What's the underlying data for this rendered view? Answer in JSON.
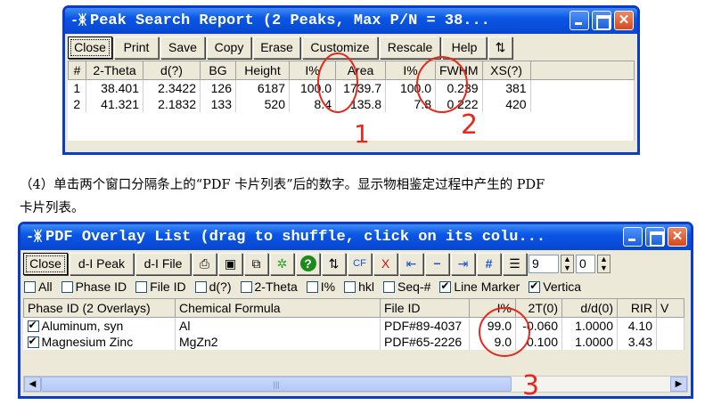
{
  "peak_window": {
    "title": "Peak Search Report (2 Peaks, Max P/N = 38...",
    "buttons": [
      "Close",
      "Print",
      "Save",
      "Copy",
      "Erase",
      "Customize",
      "Rescale",
      "Help"
    ],
    "columns": [
      "#",
      "2-Theta",
      "d(?)",
      "BG",
      "Height",
      "I%",
      "Area",
      "I%",
      "FWHM",
      "XS(?)"
    ],
    "rows": [
      [
        "1",
        "38.401",
        "2.3422",
        "126",
        "6187",
        "100.0",
        "1739.7",
        "100.0",
        "0.239",
        "381"
      ],
      [
        "2",
        "41.321",
        "2.1832",
        "133",
        "520",
        "8.4",
        "135.8",
        "7.8",
        "0.222",
        "420"
      ]
    ]
  },
  "caption": {
    "line1": "（4）单击两个窗口分隔条上的“PDF 卡片列表”后的数字。显示物相鉴定过程中产生的 PDF",
    "line2": "卡片列表。"
  },
  "pdf_window": {
    "title": "PDF Overlay List (drag to shuffle, click on its colu...",
    "buttons": {
      "close": "Close",
      "dl_peak": "d-I Peak",
      "dl_file": "d-I File"
    },
    "icon_buttons": {
      "cf": "CF",
      "x": "X",
      "hash": "#"
    },
    "spin_values": [
      "9",
      "0"
    ],
    "checkboxes": [
      {
        "label": "All",
        "checked": false
      },
      {
        "label": "Phase ID",
        "checked": false
      },
      {
        "label": "File ID",
        "checked": false
      },
      {
        "label": "d(?)",
        "checked": false
      },
      {
        "label": "2-Theta",
        "checked": false
      },
      {
        "label": "I%",
        "checked": false
      },
      {
        "label": "hkl",
        "checked": false
      },
      {
        "label": "Seq-#",
        "checked": false
      },
      {
        "label": "Line Marker",
        "checked": true
      },
      {
        "label": "Vertica",
        "checked": true
      }
    ],
    "columns": [
      "Phase ID (2 Overlays)",
      "Chemical Formula",
      "File ID",
      "I%",
      "2T(0)",
      "d/d(0)",
      "RIR",
      "V"
    ],
    "rows": [
      {
        "phase": "Aluminum, syn",
        "formula": "Al",
        "file": "PDF#89-4037",
        "i": "99.0",
        "t": "-0.060",
        "d": "1.0000",
        "rir": "4.10",
        "checked": true
      },
      {
        "phase": "Magnesium Zinc",
        "formula": "MgZn2",
        "file": "PDF#65-2226",
        "i": "9.0",
        "t": "0.100",
        "d": "1.0000",
        "rir": "3.43",
        "checked": true
      }
    ]
  },
  "annotations": {
    "mark1": "1",
    "mark2": "2",
    "mark3": "3",
    "color": "#e8261c"
  }
}
